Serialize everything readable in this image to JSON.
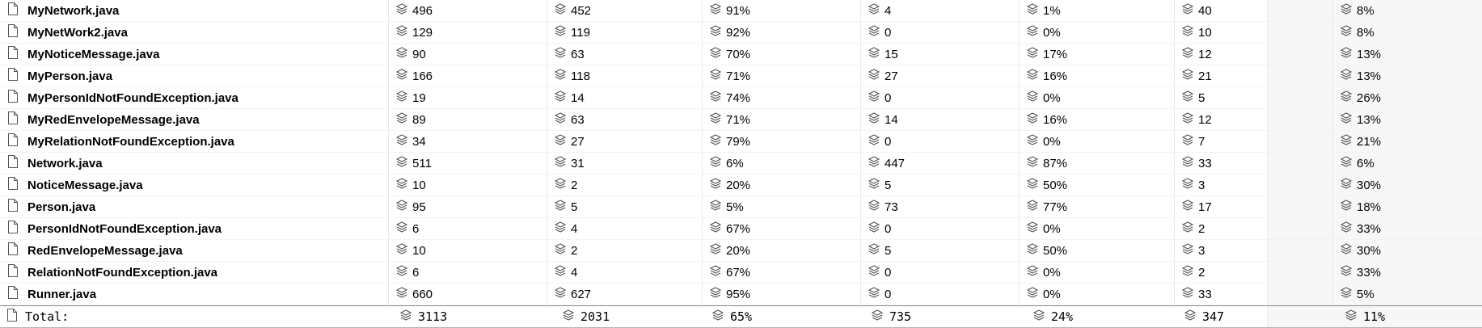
{
  "rows": [
    {
      "file": "MyNetwork.java",
      "vals": [
        "496",
        "452",
        "91%",
        "4",
        "1%",
        "40",
        "8%"
      ]
    },
    {
      "file": "MyNetWork2.java",
      "vals": [
        "129",
        "119",
        "92%",
        "0",
        "0%",
        "10",
        "8%"
      ]
    },
    {
      "file": "MyNoticeMessage.java",
      "vals": [
        "90",
        "63",
        "70%",
        "15",
        "17%",
        "12",
        "13%"
      ]
    },
    {
      "file": "MyPerson.java",
      "vals": [
        "166",
        "118",
        "71%",
        "27",
        "16%",
        "21",
        "13%"
      ]
    },
    {
      "file": "MyPersonIdNotFoundException.java",
      "vals": [
        "19",
        "14",
        "74%",
        "0",
        "0%",
        "5",
        "26%"
      ]
    },
    {
      "file": "MyRedEnvelopeMessage.java",
      "vals": [
        "89",
        "63",
        "71%",
        "14",
        "16%",
        "12",
        "13%"
      ]
    },
    {
      "file": "MyRelationNotFoundException.java",
      "vals": [
        "34",
        "27",
        "79%",
        "0",
        "0%",
        "7",
        "21%"
      ]
    },
    {
      "file": "Network.java",
      "vals": [
        "511",
        "31",
        "6%",
        "447",
        "87%",
        "33",
        "6%"
      ]
    },
    {
      "file": "NoticeMessage.java",
      "vals": [
        "10",
        "2",
        "20%",
        "5",
        "50%",
        "3",
        "30%"
      ]
    },
    {
      "file": "Person.java",
      "vals": [
        "95",
        "5",
        "5%",
        "73",
        "77%",
        "17",
        "18%"
      ]
    },
    {
      "file": "PersonIdNotFoundException.java",
      "vals": [
        "6",
        "4",
        "67%",
        "0",
        "0%",
        "2",
        "33%"
      ]
    },
    {
      "file": "RedEnvelopeMessage.java",
      "vals": [
        "10",
        "2",
        "20%",
        "5",
        "50%",
        "3",
        "30%"
      ]
    },
    {
      "file": "RelationNotFoundException.java",
      "vals": [
        "6",
        "4",
        "67%",
        "0",
        "0%",
        "2",
        "33%"
      ]
    },
    {
      "file": "Runner.java",
      "vals": [
        "660",
        "627",
        "95%",
        "0",
        "0%",
        "33",
        "5%"
      ]
    }
  ],
  "total": {
    "label": "Total:",
    "vals": [
      "3113",
      "2031",
      "65%",
      "735",
      "24%",
      "347",
      "11%"
    ]
  },
  "icons": {
    "file": "file-icon",
    "stat": "layers-icon"
  },
  "colors": {
    "grid": "#e8e8e8",
    "icon": "#555555",
    "total_border": "#8a8a8a"
  }
}
